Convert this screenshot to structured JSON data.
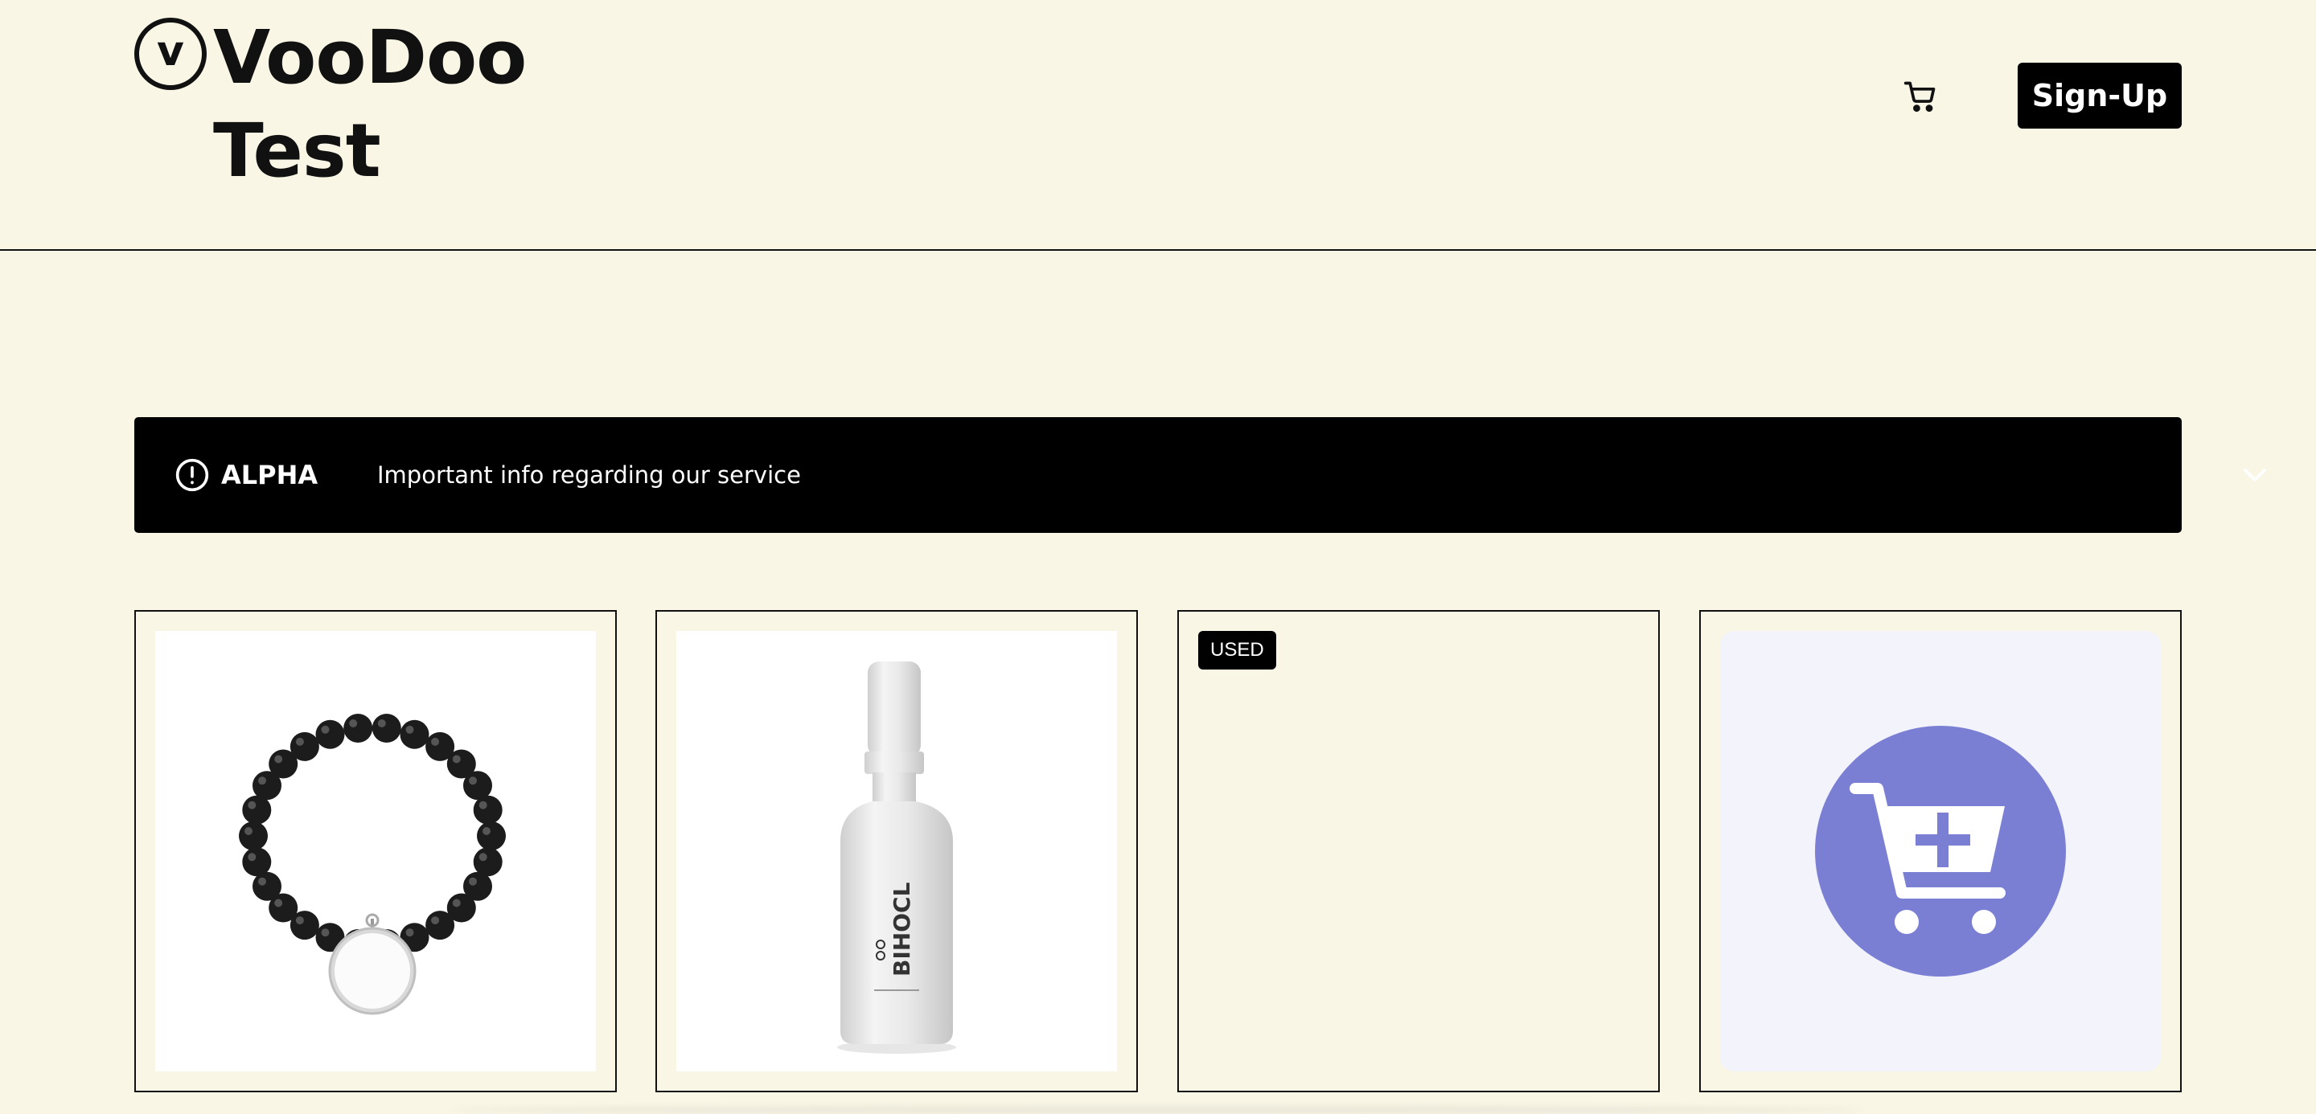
{
  "brand": {
    "mark": "v",
    "name": "VooDoo Test"
  },
  "header": {
    "cart_icon": "cart-icon",
    "signup_label": "Sign-Up"
  },
  "banner": {
    "icon": "alert-circle-icon",
    "tag": "ALPHA",
    "message": "Important info regarding our service",
    "toggle_icon": "chevron-down-icon"
  },
  "products": [
    {
      "image": "bead-bracelet-image",
      "badge": ""
    },
    {
      "image": "spray-bottle-image",
      "badge": ""
    },
    {
      "image": "",
      "badge": "USED"
    },
    {
      "image": "add-to-cart-image",
      "badge": ""
    }
  ],
  "bottle_label": "BIHOCL",
  "colors": {
    "background": "#f9f6e6",
    "dark": "#000000",
    "cart_purple": "#7b7fd4",
    "cart_tile": "#f3f3fb"
  }
}
